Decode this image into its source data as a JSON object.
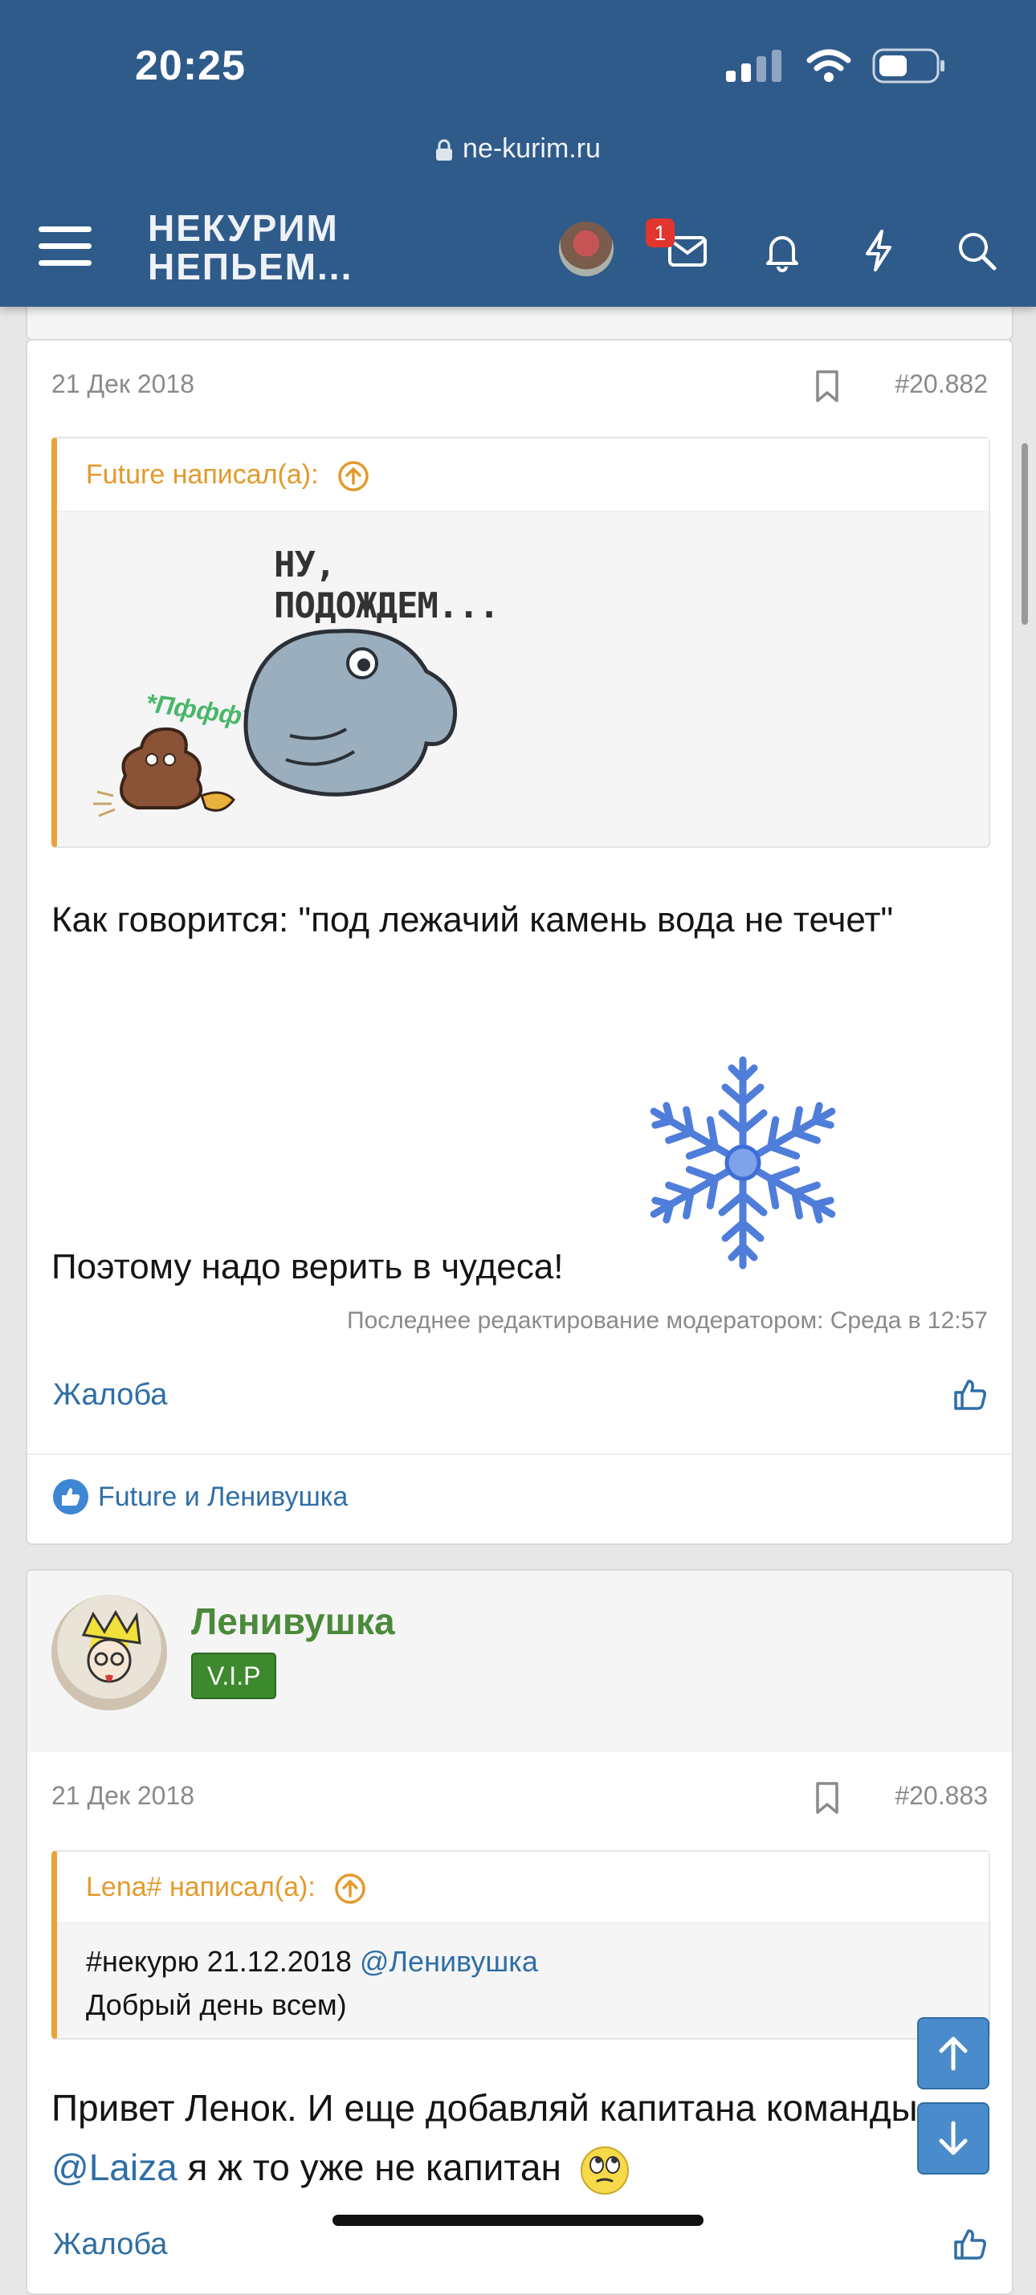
{
  "status": {
    "time": "20:25"
  },
  "browser": {
    "url": "ne-kurim.ru"
  },
  "header": {
    "logo_line1": "НЕКУРИМ",
    "logo_line2": "НЕПЬЕМ...",
    "messages_badge": "1"
  },
  "posts": [
    {
      "date": "21 Дек 2018",
      "number": "#20.882",
      "quote": {
        "author": "Future написал(а):",
        "sticker_text": "НУ, ПОДОЖДЕМ...",
        "sticker_sub": "*Пффф*"
      },
      "text1": "Как говорится: \"под лежачий камень вода не течет\"",
      "text2": "Поэтому надо верить в чудеса!",
      "edited": "Последнее редактирование модератором: Среда в 12:57",
      "complaint": "Жалоба",
      "reactions": "Future и Ленивушка"
    },
    {
      "username": "Ленивушка",
      "badge": "V.I.P",
      "date": "21 Дек 2018",
      "number": "#20.883",
      "quote": {
        "author": "Lena# написал(а):",
        "line1_text": "#некурю 21.12.2018 ",
        "line1_mention": "@Ленивушка",
        "line2": "Добрый день всем)"
      },
      "text_line1": "Привет Ленок. И еще добавляй капитана команды",
      "mention": "@Laiza",
      "text_line2": " я ж то уже не капитан",
      "complaint": "Жалоба"
    }
  ],
  "colors": {
    "header_bg": "#2f5b8a",
    "quote_accent": "#e8a43a",
    "link": "#2f6ea6",
    "username": "#4b8a3b"
  }
}
